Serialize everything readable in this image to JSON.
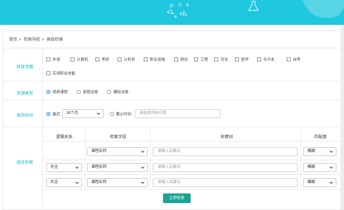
{
  "breadcrumb": {
    "home": "首页",
    "sep": ">",
    "nav": "检索导航",
    "current": "高级检索"
  },
  "rows": {
    "subject": {
      "label": "科目专辑",
      "options": [
        "外语",
        "计算机",
        "考研",
        "公务员",
        "职业资格",
        "财经",
        "工程",
        "司法",
        "医学",
        "专升本",
        "自考",
        "实用职业技能"
      ]
    },
    "resource_type": {
      "label": "资源类型",
      "options": [
        "视频课程",
        "真题试卷",
        "模拟试卷"
      ],
      "selected": "视频课程"
    },
    "publish_time": {
      "label": "发布时间",
      "recent_label": "最近",
      "recent_value": "36个月",
      "until_label": "截止时间",
      "date_placeholder": "请选择开始日期",
      "selected": "最近"
    },
    "combined": {
      "label": "组合检索",
      "headers": {
        "logic": "逻辑关系",
        "field": "检索字段",
        "keyword": "关键词",
        "match": "匹配度"
      },
      "rows": [
        {
          "logic": "",
          "field": "课程名称",
          "keyword_placeholder": "请输入关键词",
          "match": "模糊"
        },
        {
          "logic": "并且",
          "field": "课程名称",
          "keyword_placeholder": "请输入关键词",
          "match": "模糊"
        },
        {
          "logic": "并且",
          "field": "课程名称",
          "keyword_placeholder": "请输入关键词",
          "match": "模糊"
        }
      ]
    }
  },
  "submit_label": "立即检索",
  "colors": {
    "banner": "#1fc7df",
    "label": "#13b4c8",
    "submit": "#1aa394",
    "radio": "#3c8ad8"
  }
}
